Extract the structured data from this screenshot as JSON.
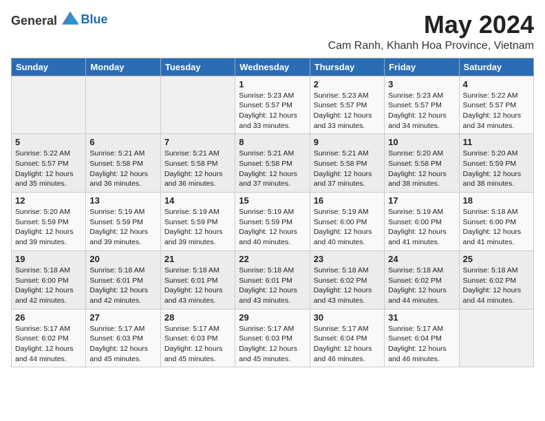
{
  "logo": {
    "general": "General",
    "blue": "Blue"
  },
  "header": {
    "month": "May 2024",
    "location": "Cam Ranh, Khanh Hoa Province, Vietnam"
  },
  "weekdays": [
    "Sunday",
    "Monday",
    "Tuesday",
    "Wednesday",
    "Thursday",
    "Friday",
    "Saturday"
  ],
  "weeks": [
    [
      {
        "day": "",
        "info": ""
      },
      {
        "day": "",
        "info": ""
      },
      {
        "day": "",
        "info": ""
      },
      {
        "day": "1",
        "info": "Sunrise: 5:23 AM\nSunset: 5:57 PM\nDaylight: 12 hours\nand 33 minutes."
      },
      {
        "day": "2",
        "info": "Sunrise: 5:23 AM\nSunset: 5:57 PM\nDaylight: 12 hours\nand 33 minutes."
      },
      {
        "day": "3",
        "info": "Sunrise: 5:23 AM\nSunset: 5:57 PM\nDaylight: 12 hours\nand 34 minutes."
      },
      {
        "day": "4",
        "info": "Sunrise: 5:22 AM\nSunset: 5:57 PM\nDaylight: 12 hours\nand 34 minutes."
      }
    ],
    [
      {
        "day": "5",
        "info": "Sunrise: 5:22 AM\nSunset: 5:57 PM\nDaylight: 12 hours\nand 35 minutes."
      },
      {
        "day": "6",
        "info": "Sunrise: 5:21 AM\nSunset: 5:58 PM\nDaylight: 12 hours\nand 36 minutes."
      },
      {
        "day": "7",
        "info": "Sunrise: 5:21 AM\nSunset: 5:58 PM\nDaylight: 12 hours\nand 36 minutes."
      },
      {
        "day": "8",
        "info": "Sunrise: 5:21 AM\nSunset: 5:58 PM\nDaylight: 12 hours\nand 37 minutes."
      },
      {
        "day": "9",
        "info": "Sunrise: 5:21 AM\nSunset: 5:58 PM\nDaylight: 12 hours\nand 37 minutes."
      },
      {
        "day": "10",
        "info": "Sunrise: 5:20 AM\nSunset: 5:58 PM\nDaylight: 12 hours\nand 38 minutes."
      },
      {
        "day": "11",
        "info": "Sunrise: 5:20 AM\nSunset: 5:59 PM\nDaylight: 12 hours\nand 38 minutes."
      }
    ],
    [
      {
        "day": "12",
        "info": "Sunrise: 5:20 AM\nSunset: 5:59 PM\nDaylight: 12 hours\nand 39 minutes."
      },
      {
        "day": "13",
        "info": "Sunrise: 5:19 AM\nSunset: 5:59 PM\nDaylight: 12 hours\nand 39 minutes."
      },
      {
        "day": "14",
        "info": "Sunrise: 5:19 AM\nSunset: 5:59 PM\nDaylight: 12 hours\nand 39 minutes."
      },
      {
        "day": "15",
        "info": "Sunrise: 5:19 AM\nSunset: 5:59 PM\nDaylight: 12 hours\nand 40 minutes."
      },
      {
        "day": "16",
        "info": "Sunrise: 5:19 AM\nSunset: 6:00 PM\nDaylight: 12 hours\nand 40 minutes."
      },
      {
        "day": "17",
        "info": "Sunrise: 5:19 AM\nSunset: 6:00 PM\nDaylight: 12 hours\nand 41 minutes."
      },
      {
        "day": "18",
        "info": "Sunrise: 5:18 AM\nSunset: 6:00 PM\nDaylight: 12 hours\nand 41 minutes."
      }
    ],
    [
      {
        "day": "19",
        "info": "Sunrise: 5:18 AM\nSunset: 6:00 PM\nDaylight: 12 hours\nand 42 minutes."
      },
      {
        "day": "20",
        "info": "Sunrise: 5:18 AM\nSunset: 6:01 PM\nDaylight: 12 hours\nand 42 minutes."
      },
      {
        "day": "21",
        "info": "Sunrise: 5:18 AM\nSunset: 6:01 PM\nDaylight: 12 hours\nand 43 minutes."
      },
      {
        "day": "22",
        "info": "Sunrise: 5:18 AM\nSunset: 6:01 PM\nDaylight: 12 hours\nand 43 minutes."
      },
      {
        "day": "23",
        "info": "Sunrise: 5:18 AM\nSunset: 6:02 PM\nDaylight: 12 hours\nand 43 minutes."
      },
      {
        "day": "24",
        "info": "Sunrise: 5:18 AM\nSunset: 6:02 PM\nDaylight: 12 hours\nand 44 minutes."
      },
      {
        "day": "25",
        "info": "Sunrise: 5:18 AM\nSunset: 6:02 PM\nDaylight: 12 hours\nand 44 minutes."
      }
    ],
    [
      {
        "day": "26",
        "info": "Sunrise: 5:17 AM\nSunset: 6:02 PM\nDaylight: 12 hours\nand 44 minutes."
      },
      {
        "day": "27",
        "info": "Sunrise: 5:17 AM\nSunset: 6:03 PM\nDaylight: 12 hours\nand 45 minutes."
      },
      {
        "day": "28",
        "info": "Sunrise: 5:17 AM\nSunset: 6:03 PM\nDaylight: 12 hours\nand 45 minutes."
      },
      {
        "day": "29",
        "info": "Sunrise: 5:17 AM\nSunset: 6:03 PM\nDaylight: 12 hours\nand 45 minutes."
      },
      {
        "day": "30",
        "info": "Sunrise: 5:17 AM\nSunset: 6:04 PM\nDaylight: 12 hours\nand 46 minutes."
      },
      {
        "day": "31",
        "info": "Sunrise: 5:17 AM\nSunset: 6:04 PM\nDaylight: 12 hours\nand 46 minutes."
      },
      {
        "day": "",
        "info": ""
      }
    ]
  ]
}
